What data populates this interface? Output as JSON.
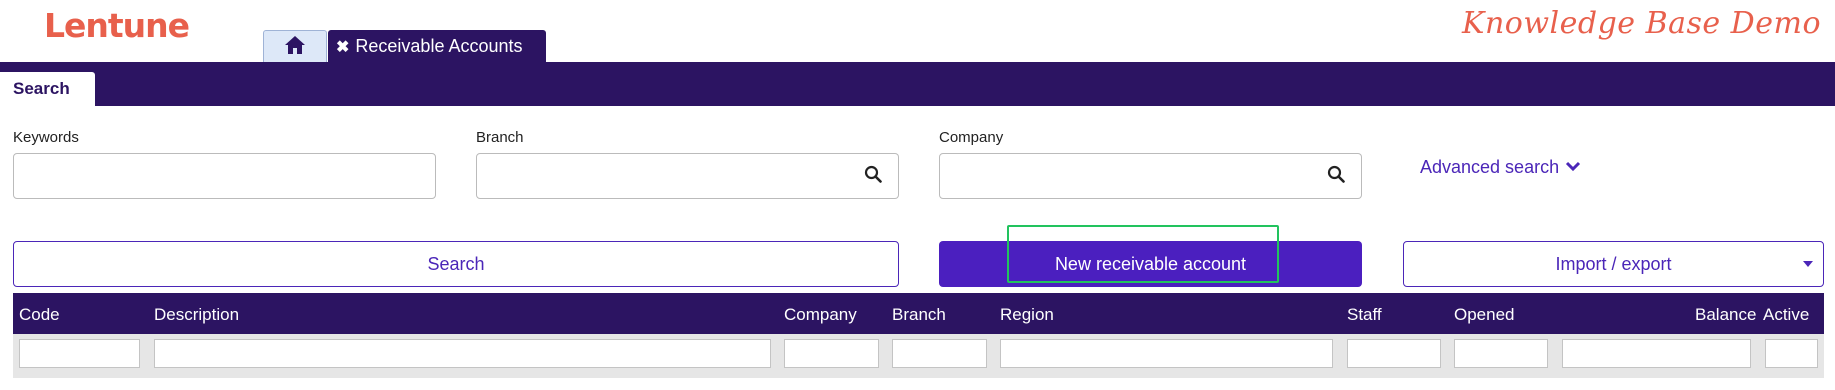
{
  "app": {
    "logo": "Lentune",
    "banner": "Knowledge Base Demo"
  },
  "tabs": {
    "home_icon": "home-icon",
    "active_label": "Receivable Accounts",
    "close_glyph": "✖"
  },
  "panel": {
    "search_tab": "Search"
  },
  "fields": {
    "keywords_label": "Keywords",
    "keywords_value": "",
    "branch_label": "Branch",
    "branch_value": "",
    "company_label": "Company",
    "company_value": ""
  },
  "advanced": {
    "label": "Advanced search"
  },
  "actions": {
    "search": "Search",
    "new_account": "New receivable account",
    "import_export": "Import / export"
  },
  "grid": {
    "columns": [
      "Code",
      "Description",
      "Company",
      "Branch",
      "Region",
      "Staff",
      "Opened",
      "Balance",
      "Active"
    ]
  },
  "colors": {
    "brand": "#e8604c",
    "navy": "#2c1462",
    "accent": "#4b1fbf",
    "highlight": "#22c35e"
  }
}
